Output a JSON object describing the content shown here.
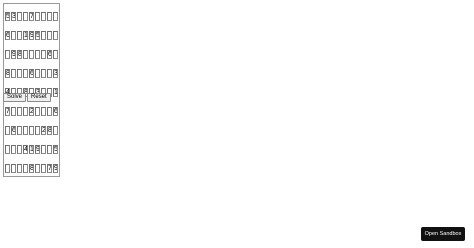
{
  "board": {
    "rows": [
      [
        "5",
        "3",
        "",
        "",
        "7",
        "",
        "",
        "",
        ""
      ],
      [
        "6",
        "",
        "",
        "1",
        "9",
        "5",
        "",
        "",
        ""
      ],
      [
        "",
        "9",
        "8",
        "",
        "",
        "",
        "",
        "6",
        ""
      ],
      [
        "8",
        "",
        "",
        "",
        "6",
        "",
        "",
        "",
        "3"
      ],
      [
        "4",
        "",
        "",
        "8",
        "",
        "3",
        "",
        "",
        "1"
      ],
      [
        "7",
        "",
        "",
        "",
        "2",
        "",
        "",
        "",
        "6"
      ],
      [
        "",
        "6",
        "",
        "",
        "",
        "",
        "2",
        "8",
        ""
      ],
      [
        "",
        "",
        "",
        "4",
        "1",
        "9",
        "",
        "",
        "5"
      ],
      [
        "",
        "",
        "",
        "",
        "8",
        "",
        "",
        "7",
        "9"
      ]
    ]
  },
  "controls": {
    "solve_label": "Solve",
    "reset_label": "Reset"
  },
  "sandbox": {
    "open_label": "Open Sandbox"
  }
}
